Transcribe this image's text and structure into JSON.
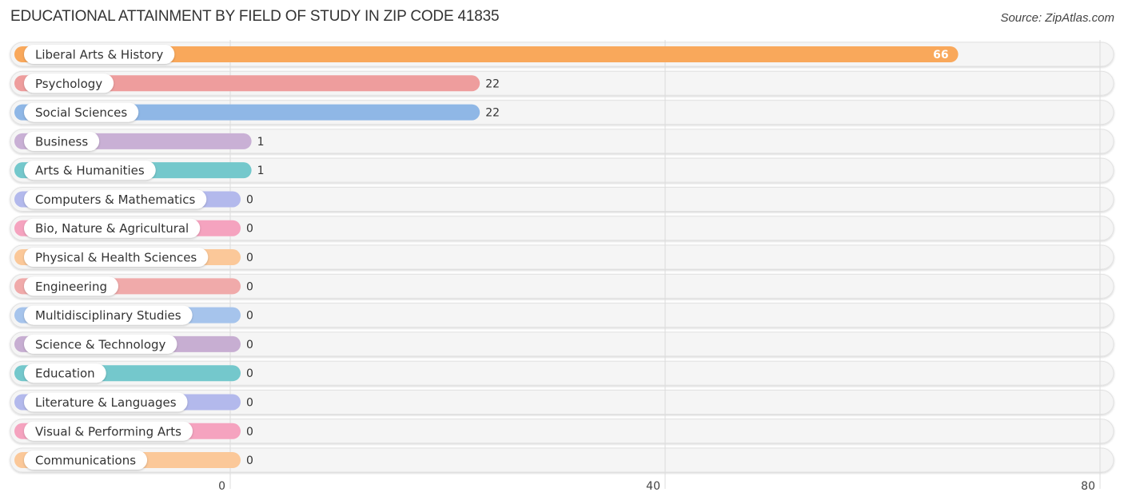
{
  "header": {
    "title": "EDUCATIONAL ATTAINMENT BY FIELD OF STUDY IN ZIP CODE 41835",
    "source": "Source: ZipAtlas.com"
  },
  "chart_data": {
    "type": "bar",
    "orientation": "horizontal",
    "title": "EDUCATIONAL ATTAINMENT BY FIELD OF STUDY IN ZIP CODE 41835",
    "xlabel": "",
    "ylabel": "",
    "xlim": [
      0,
      80
    ],
    "xticks": [
      0,
      40,
      80
    ],
    "grid": true,
    "legend": "none",
    "categories": [
      "Liberal Arts & History",
      "Psychology",
      "Social Sciences",
      "Business",
      "Arts & Humanities",
      "Computers & Mathematics",
      "Bio, Nature & Agricultural",
      "Physical & Health Sciences",
      "Engineering",
      "Multidisciplinary Studies",
      "Science & Technology",
      "Education",
      "Literature & Languages",
      "Visual & Performing Arts",
      "Communications"
    ],
    "values": [
      66,
      22,
      22,
      1,
      1,
      0,
      0,
      0,
      0,
      0,
      0,
      0,
      0,
      0,
      0
    ],
    "colors": [
      "#f9a85b",
      "#ee9d9d",
      "#8fb7e6",
      "#c9b0d5",
      "#74c8cc",
      "#b3b9ec",
      "#f5a3bf",
      "#fbc899",
      "#f0aaaa",
      "#a6c4ec",
      "#c7aed2",
      "#74c8cc",
      "#b3b9ec",
      "#f5a3bf",
      "#fbc899"
    ]
  }
}
